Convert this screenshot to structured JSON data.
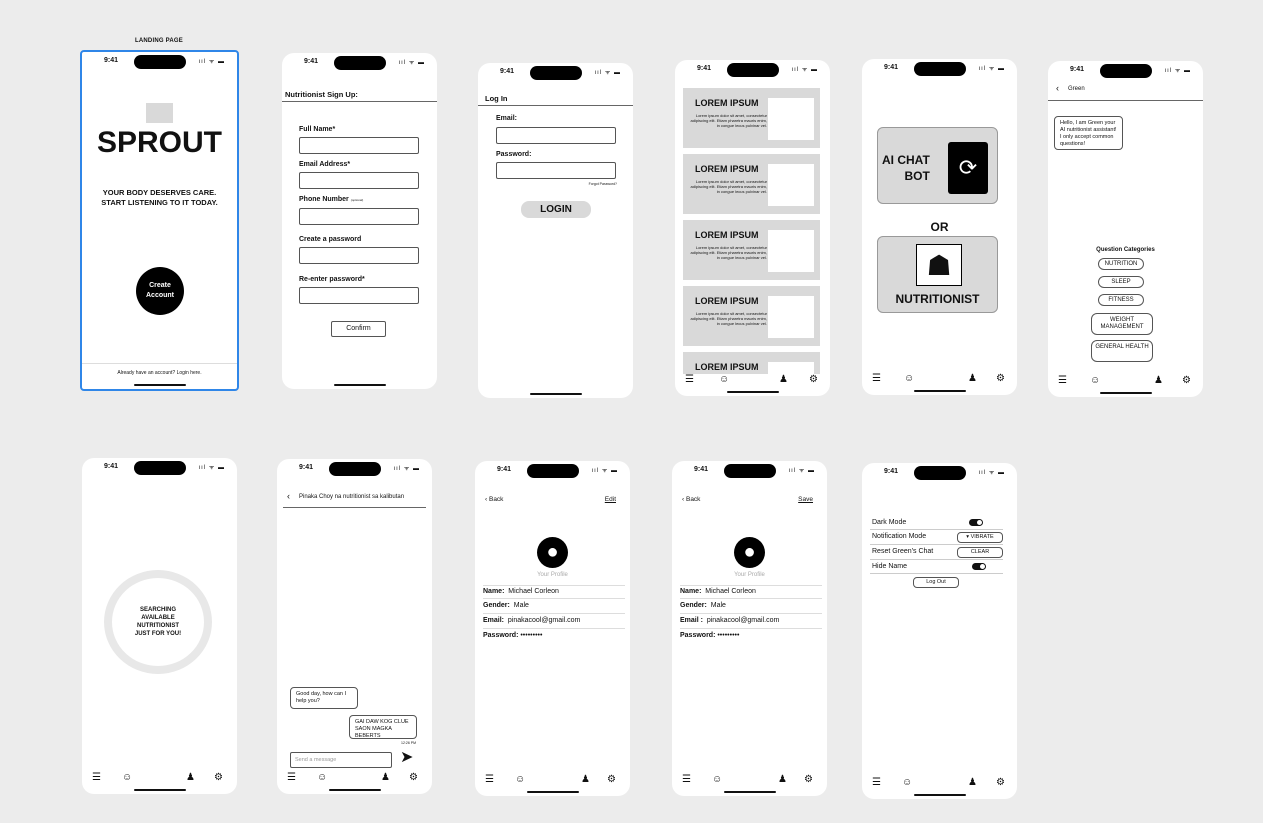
{
  "status": {
    "time": "9:41",
    "signal": "ııl ᯤ ▬"
  },
  "landing": {
    "caption": "LANDING PAGE",
    "brand": "SPROUT",
    "tagline": "YOUR BODY DESERVES CARE. START LISTENING TO IT TODAY.",
    "create_button": "Create Account",
    "login_link": "Already have an account? Login here."
  },
  "signup": {
    "title": "Nutritionist Sign Up:",
    "full_name": "Full Name*",
    "email": "Email Address*",
    "phone": "Phone Number",
    "phone_note": "(optional)",
    "password": "Create a password",
    "reenter": "Re-enter password*",
    "confirm": "Confirm"
  },
  "login": {
    "title": "Log In",
    "email": "Email:",
    "password": "Password:",
    "forgot": "Forgot Password?",
    "button": "LOGIN"
  },
  "feed": {
    "cards": [
      {
        "title": "LOREM IPSUM",
        "body": "Lorem ipsum dolor sit amet, consectetur adipiscing elit. Etiam pharetra mauris enim, in congue lecus pulvinar vel."
      },
      {
        "title": "LOREM IPSUM",
        "body": "Lorem ipsum dolor sit amet, consectetur adipiscing elit. Etiam pharetra mauris enim, in congue lecus pulvinar vel."
      },
      {
        "title": "LOREM IPSUM",
        "body": "Lorem ipsum dolor sit amet, consectetur adipiscing elit. Etiam pharetra mauris enim, in congue lecus pulvinar vel."
      },
      {
        "title": "LOREM IPSUM",
        "body": "Lorem ipsum dolor sit amet, consectetur adipiscing elit. Etiam pharetra mauris enim, in congue lecus pulvinar vel."
      },
      {
        "title": "LOREM IPSUM",
        "body": ""
      }
    ]
  },
  "choose": {
    "ai_line1": "AI CHAT",
    "ai_line2": "BOT",
    "or": "OR",
    "nutritionist": "NUTRITIONIST"
  },
  "green_chat": {
    "header": "Green",
    "greeting": "Hello, I am Green your AI nutritionist assistant! I only accept common questions!",
    "categories_title": "Question Categories",
    "categories": [
      "NUTRITION",
      "SLEEP",
      "FITNESS",
      "WEIGHT MANAGEMENT",
      "GENERAL HEALTH"
    ]
  },
  "searching": {
    "text": "SEARCHING AVAILABLE NUTRITIONIST JUST FOR YOU!"
  },
  "nutri_chat": {
    "header": "Pinaka Choy na nutritionist sa kalibutan",
    "msg_in": "Good day, how can I help you?",
    "msg_out": "GAI DAW KOG CLUE SAON MAGKA BEBERTS",
    "msg_time": "12:26 PM",
    "input_placeholder": "Send a message"
  },
  "profile_view": {
    "back": "Back",
    "action": "Edit",
    "your_profile": "Your Profile",
    "name_label": "Name:",
    "name": "Michael Corleon",
    "gender_label": "Gender:",
    "gender": "Male",
    "email_label": "Email:",
    "email": "pinakacool@gmail.com",
    "password_label": "Password:",
    "password": "•••••••••"
  },
  "profile_edit": {
    "back": "Back",
    "action": "Save",
    "your_profile": "Your Profile",
    "name_label": "Name:",
    "name": "Michael Corleon",
    "gender_label": "Gender:",
    "gender": "Male",
    "email_label": "Email :",
    "email": "pinakacool@gmail.com",
    "password_label": "Password:",
    "password": "•••••••••"
  },
  "settings": {
    "dark_mode": "Dark Mode",
    "notification_mode": "Notification Mode",
    "notification_value": "VIBRATE",
    "reset_chat": "Reset Green's Chat",
    "clear": "CLEAR",
    "hide_name": "Hide Name",
    "logout": "Log Out"
  }
}
